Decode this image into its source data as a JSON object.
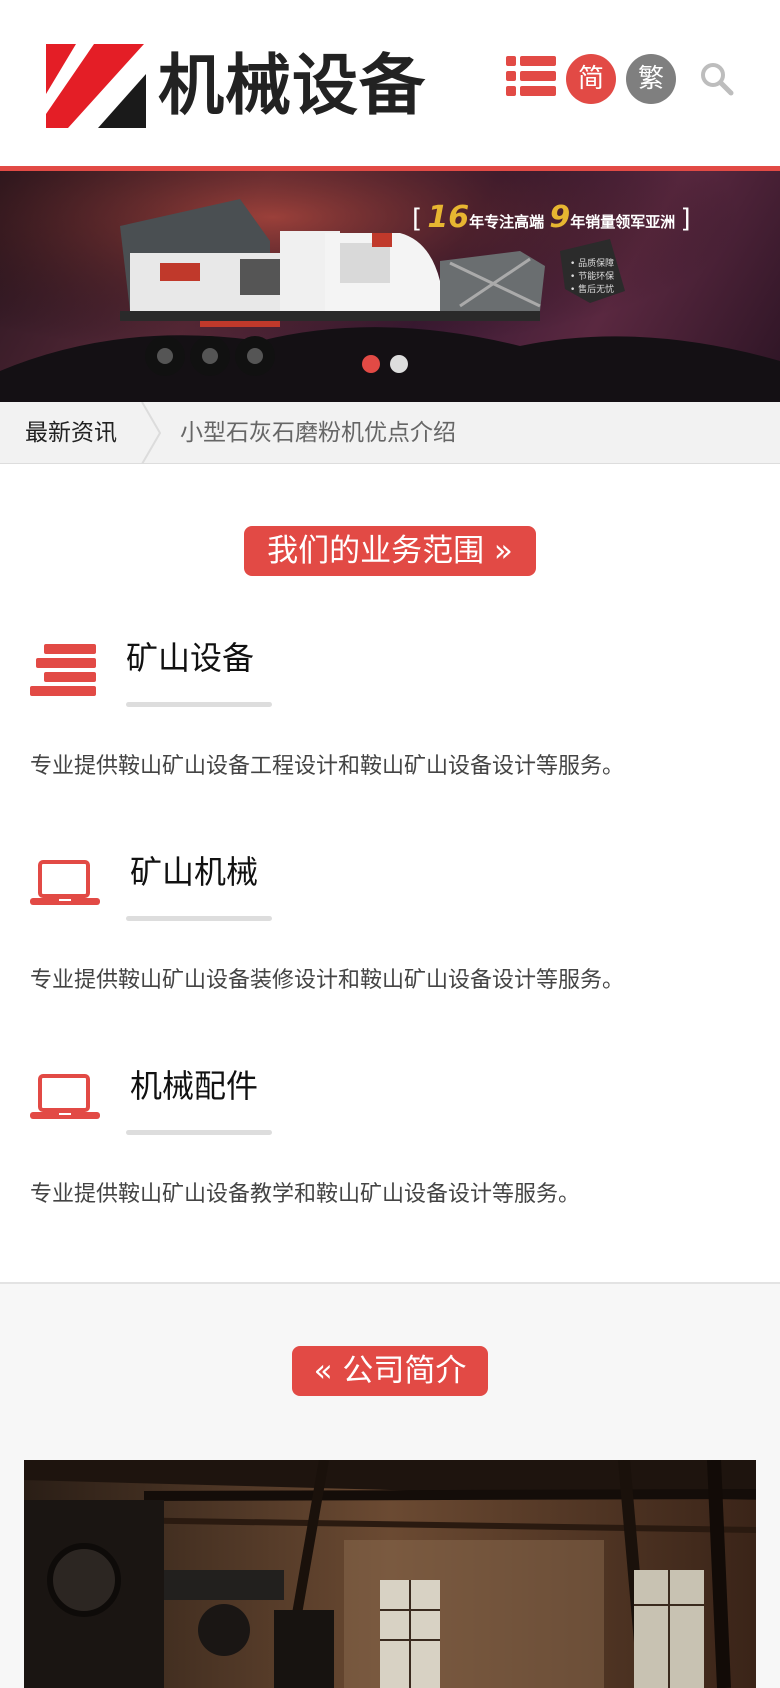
{
  "header": {
    "logo_text": "机械设备",
    "lang_simplified": "简",
    "lang_traditional": "繁"
  },
  "banner": {
    "slogan_years": "16",
    "slogan_part1": "年专注高端",
    "slogan_rank": "9",
    "slogan_part2": "年销量领军亚洲",
    "active_slide": 1,
    "slide_count": 2
  },
  "news": {
    "label": "最新资讯",
    "item": "小型石灰石磨粉机优点介绍"
  },
  "business": {
    "heading": "我们的业务范围 »",
    "services": [
      {
        "title": "矿山设备",
        "icon": "stack-bars-icon",
        "desc": "专业提供鞍山矿山设备工程设计和鞍山矿山设备设计等服务。"
      },
      {
        "title": "矿山机械",
        "icon": "laptop-icon",
        "desc": "专业提供鞍山矿山设备装修设计和鞍山矿山设备设计等服务。"
      },
      {
        "title": "机械配件",
        "icon": "laptop-icon",
        "desc": "专业提供鞍山矿山设备教学和鞍山矿山设备设计等服务。"
      }
    ]
  },
  "about": {
    "heading": "« 公司简介"
  },
  "colors": {
    "accent": "#e24a45",
    "gray_button": "#7f7f7f",
    "banner_gold": "#e7b631"
  }
}
